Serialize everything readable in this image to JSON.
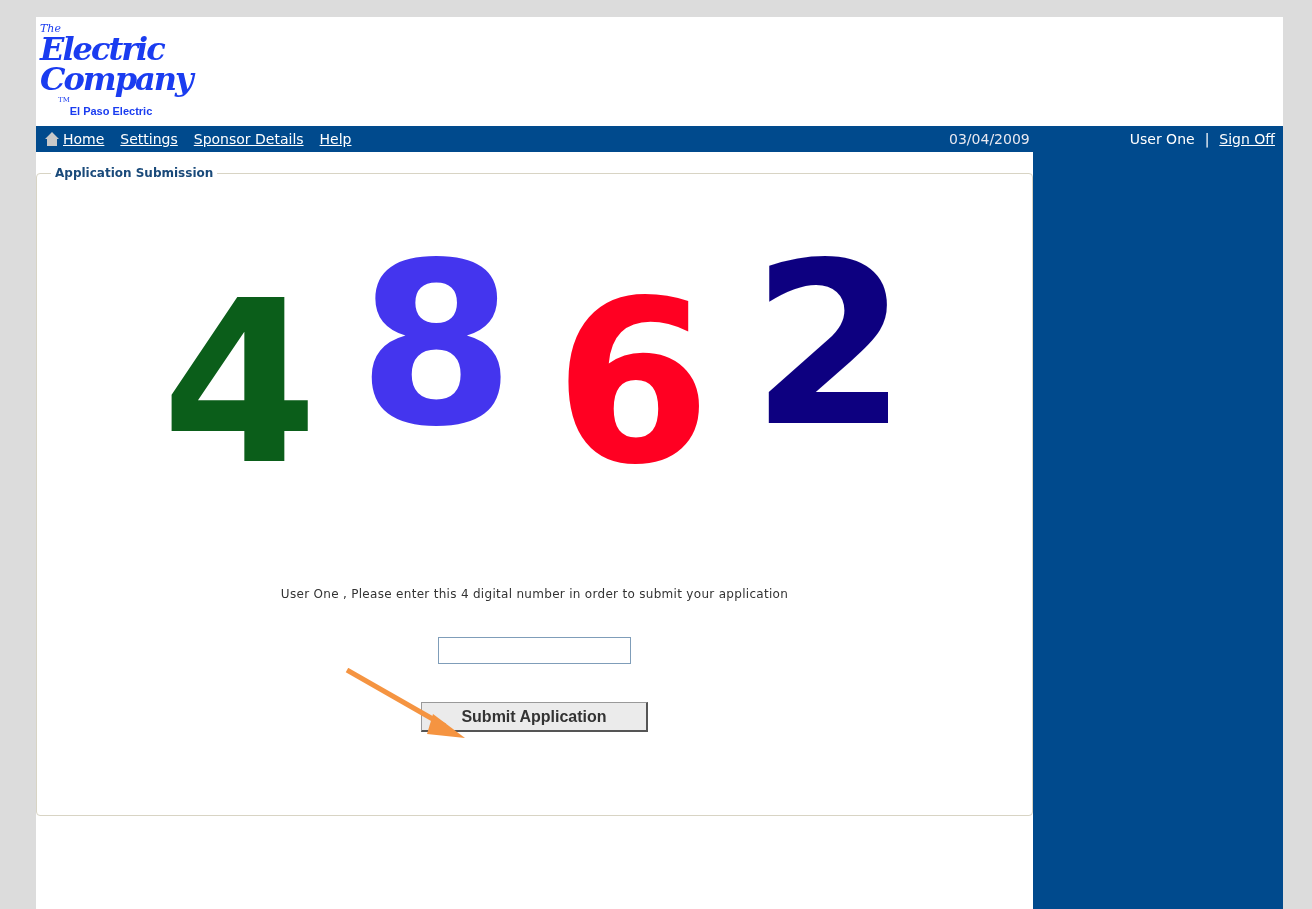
{
  "logo": {
    "the": "The",
    "line1": "Electric",
    "line2": "Company",
    "tm": "TM",
    "subtitle": "El Paso Electric"
  },
  "nav": {
    "links": [
      "Home",
      "Settings",
      "Sponsor Details",
      "Help"
    ],
    "date": "03/04/2009",
    "user": "User One",
    "separator": "|",
    "sign_off": "Sign Off"
  },
  "panel": {
    "legend": "Application Submission",
    "captcha": [
      {
        "digit": "4",
        "color": "#0b5e1a"
      },
      {
        "digit": "8",
        "color": "#4435ee"
      },
      {
        "digit": "6",
        "color": "#ff0022"
      },
      {
        "digit": "2",
        "color": "#0d0080"
      }
    ],
    "instruction": "User One , Please enter this 4 digital number in order to submit your application",
    "submit": "Submit Application"
  }
}
